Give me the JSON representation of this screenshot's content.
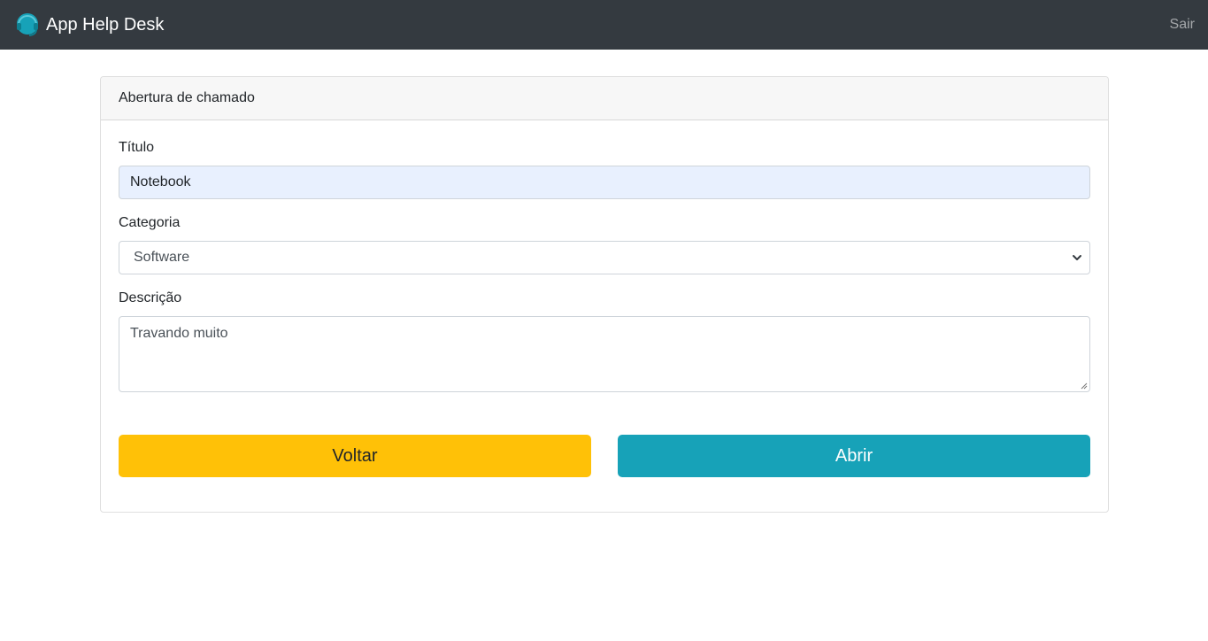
{
  "navbar": {
    "brand": "App Help Desk",
    "brand_icon": "headset-icon",
    "logout": "Sair"
  },
  "card": {
    "header": "Abertura de chamado",
    "titulo": {
      "label": "Título",
      "value": "Notebook"
    },
    "categoria": {
      "label": "Categoria",
      "selected": "Software"
    },
    "descricao": {
      "label": "Descrição",
      "value": "Travando muito"
    },
    "buttons": {
      "back": "Voltar",
      "open": "Abrir"
    }
  },
  "colors": {
    "navbar": "#343a40",
    "warning": "#ffc107",
    "info": "#17a2b8",
    "autofill": "#e8f0fe"
  }
}
